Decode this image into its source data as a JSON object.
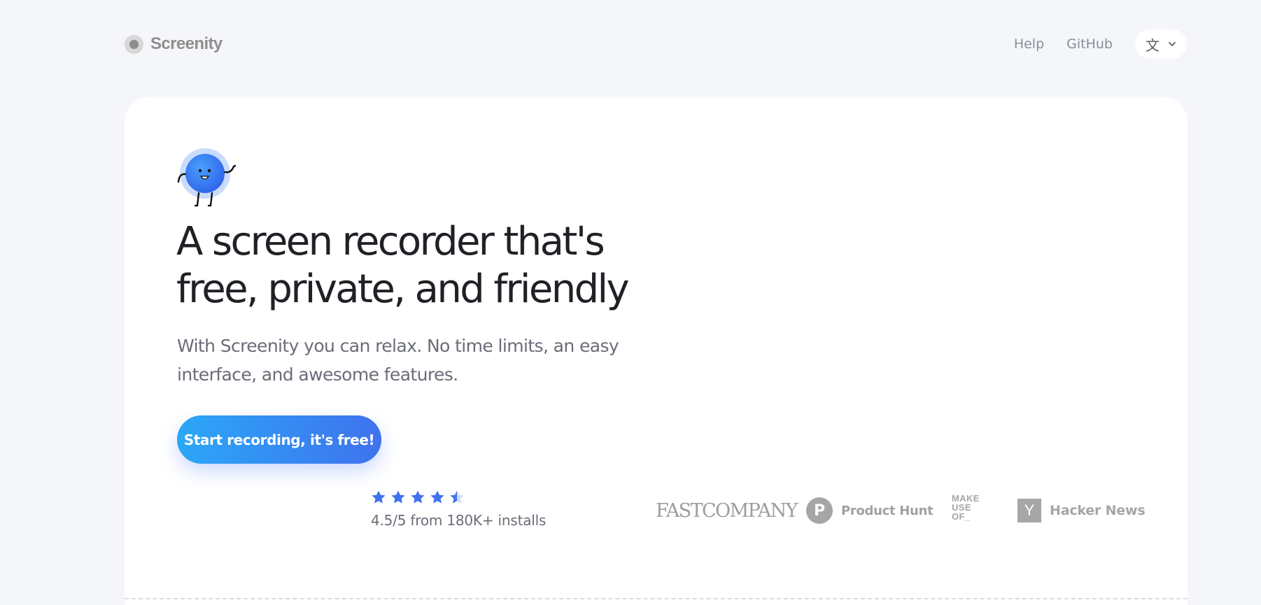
{
  "brand": {
    "name": "Screenity"
  },
  "nav": {
    "links": [
      {
        "label": "Help"
      },
      {
        "label": "GitHub"
      }
    ],
    "language_glyph": "文"
  },
  "hero": {
    "headline_line1": "A screen recorder that's",
    "headline_line2": "free, private, and friendly",
    "subheading": "With Screenity you can relax. No time limits, an easy interface, and awesome features.",
    "cta_label": "Start recording, it's free!"
  },
  "rating": {
    "stars": 4.5,
    "star_color": "#3f72ee",
    "text": "4.5/5 from 180K+ installs"
  },
  "press": {
    "fast_company": "FASTCOMPANY",
    "product_hunt_letter": "P",
    "product_hunt": "Product Hunt",
    "makeuseof_lines": [
      "MAKE",
      "USE",
      "OF_"
    ],
    "hacker_news_letter": "Y",
    "hacker_news": "Hacker News"
  },
  "colors": {
    "page_background": "#f5f6fa",
    "card_background": "#ffffff",
    "cta_gradient_start": "#2ba7f7",
    "cta_gradient_end": "#3f72ee"
  }
}
